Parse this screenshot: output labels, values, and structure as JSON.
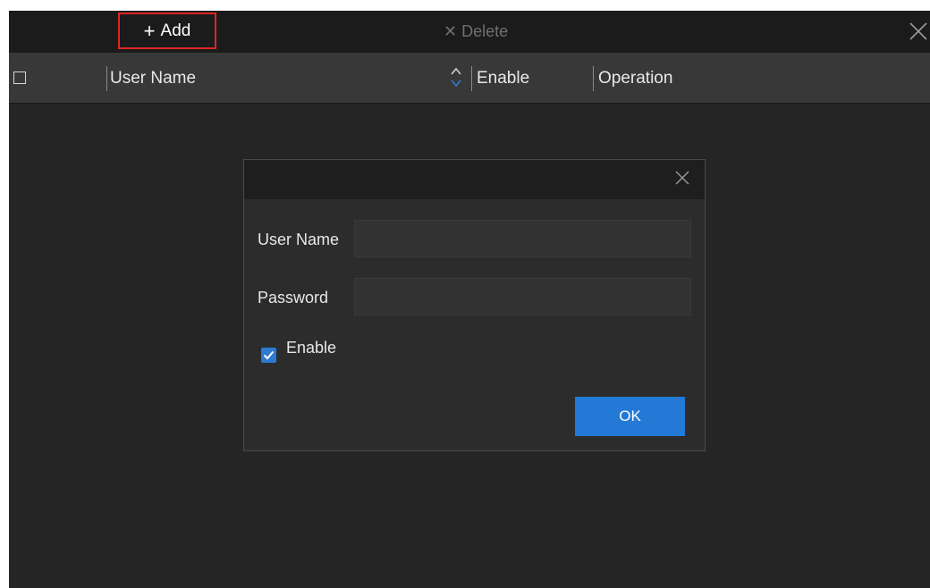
{
  "toolbar": {
    "add_icon": "+",
    "add_label": "Add",
    "delete_icon": "✕",
    "delete_label": "Delete"
  },
  "table": {
    "columns": [
      "User Name",
      "Enable",
      "Operation"
    ]
  },
  "dialog": {
    "username_label": "User Name",
    "username_value": "",
    "password_label": "Password",
    "password_value": "",
    "enable_label": "Enable",
    "enable_checked": true,
    "ok_label": "OK"
  },
  "colors": {
    "highlight_border": "#e02525",
    "accent": "#2379d6"
  },
  "icons": [
    "plus-icon",
    "close-icon",
    "sort-icon",
    "checkmark-icon"
  ]
}
